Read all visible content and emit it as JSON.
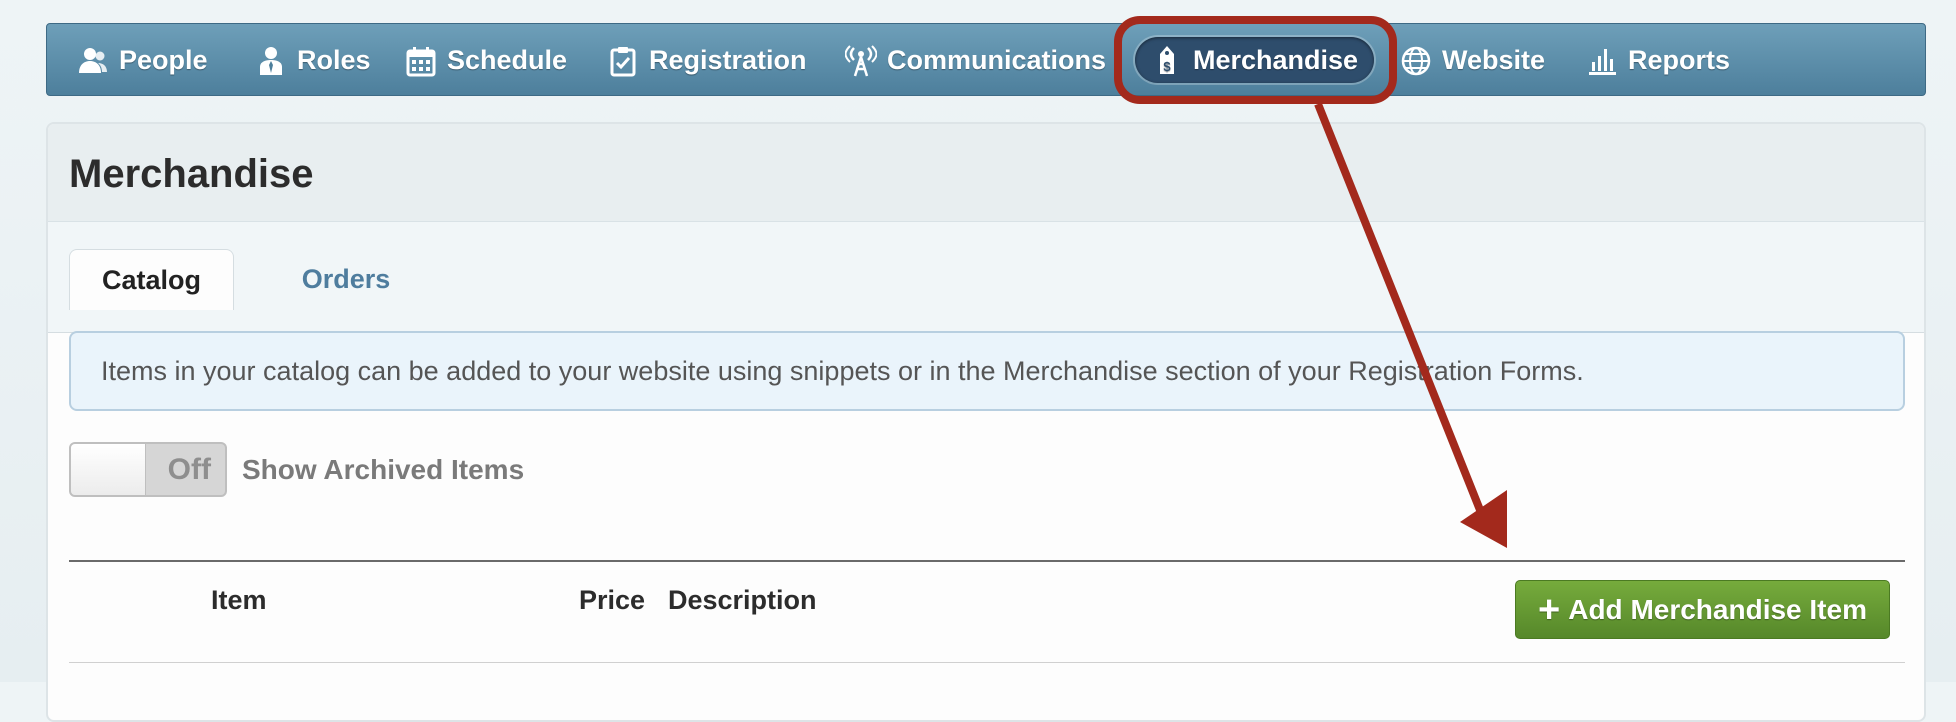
{
  "nav": {
    "items": [
      {
        "label": "People",
        "icon": "people-icon"
      },
      {
        "label": "Roles",
        "icon": "role-icon"
      },
      {
        "label": "Schedule",
        "icon": "calendar-icon"
      },
      {
        "label": "Registration",
        "icon": "clipboard-check-icon"
      },
      {
        "label": "Communications",
        "icon": "antenna-icon"
      },
      {
        "label": "Merchandise",
        "icon": "price-tag-icon",
        "active": true
      },
      {
        "label": "Website",
        "icon": "globe-icon"
      },
      {
        "label": "Reports",
        "icon": "bar-chart-icon"
      }
    ]
  },
  "page": {
    "title": "Merchandise"
  },
  "tabs": [
    {
      "label": "Catalog",
      "active": true
    },
    {
      "label": "Orders",
      "active": false
    }
  ],
  "info": {
    "text": "Items in your catalog can be added to your website using snippets or in the Merchandise section of your Registration Forms."
  },
  "archived_toggle": {
    "state": "Off",
    "label": "Show Archived Items"
  },
  "table": {
    "columns": [
      "Item",
      "Price",
      "Description"
    ]
  },
  "add_button": {
    "label": "Add Merchandise Item"
  },
  "colors": {
    "annotation": "#a3291c",
    "nav_active": "#2e4d6c",
    "button_green": "#5e9230",
    "tab_link": "#4f7d9e"
  }
}
